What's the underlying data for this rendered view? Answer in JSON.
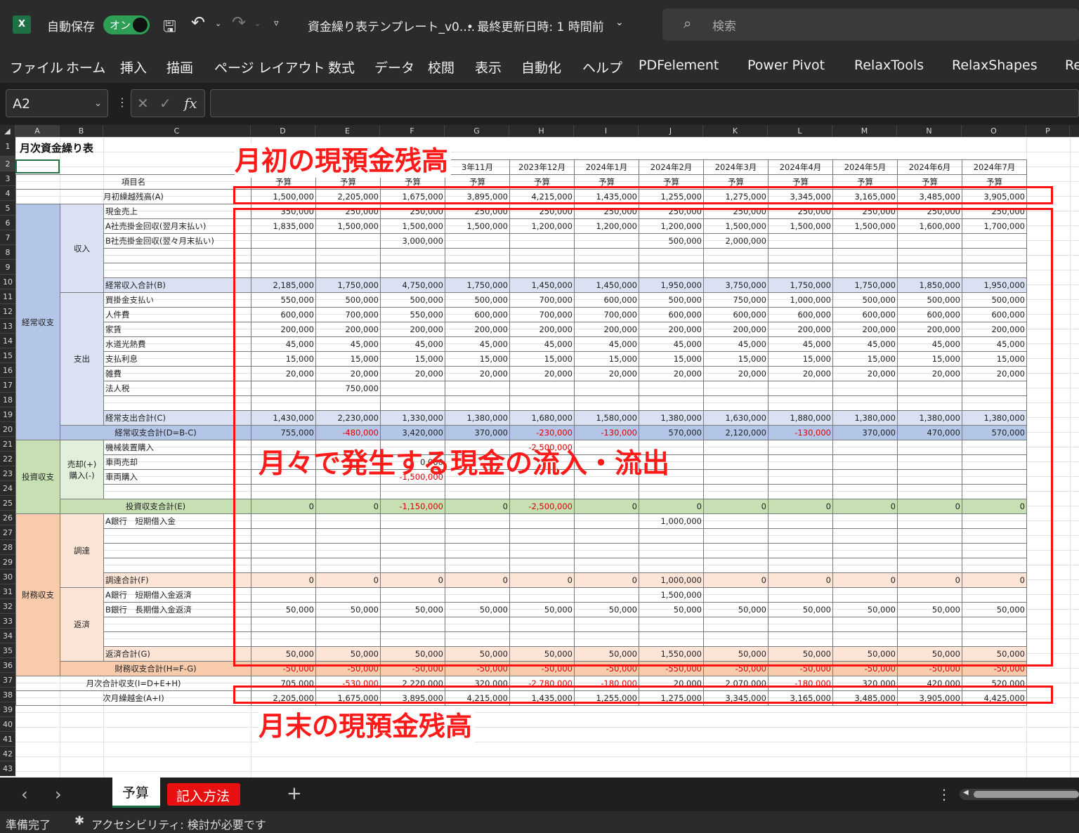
{
  "titlebar": {
    "app_icon": "excel-icon",
    "autosave_label": "自動保存",
    "autosave_toggle": "オン",
    "filename": "資金繰り表テンプレート_v0.…",
    "last_modified": "• 最終更新日時: 1 時間前",
    "search_placeholder": "検索"
  },
  "menu": [
    "ファイル",
    "ホーム",
    "挿入",
    "描画",
    "ページ レイアウト",
    "数式",
    "データ",
    "校閲",
    "表示",
    "自動化",
    "ヘルプ",
    "PDFelement",
    "Power Pivot",
    "RelaxTools",
    "RelaxShapes",
    "Re"
  ],
  "formula_bar": {
    "name_box": "A2",
    "fx": "fx",
    "value": ""
  },
  "columns": [
    "A",
    "B",
    "C",
    "D",
    "E",
    "F",
    "G",
    "H",
    "I",
    "J",
    "K",
    "L",
    "M",
    "N",
    "O",
    "P"
  ],
  "rows": [
    "1",
    "2",
    "3",
    "4",
    "5",
    "6",
    "7",
    "8",
    "9",
    "10",
    "11",
    "12",
    "13",
    "14",
    "15",
    "16",
    "17",
    "18",
    "19",
    "20",
    "21",
    "22",
    "23",
    "24",
    "25",
    "26",
    "27",
    "28",
    "29",
    "30",
    "31",
    "32",
    "33",
    "34",
    "35",
    "36",
    "37",
    "38",
    "39",
    "40",
    "41",
    "42",
    "43"
  ],
  "sheet": {
    "title": "月次資金繰り表",
    "months": [
      "",
      "",
      "",
      "3年11月",
      "2023年12月",
      "2024年1月",
      "2024年2月",
      "2024年3月",
      "2024年4月",
      "2024年5月",
      "2024年6月",
      "2024年7月"
    ],
    "item_header": "項目名",
    "budget_label": "予算",
    "rows": [
      {
        "r": "4",
        "a": "",
        "b": "",
        "c": "月初繰越残高(A)",
        "cls": "open",
        "vals": [
          "1,500,000",
          "2,205,000",
          "1,675,000",
          "3,895,000",
          "4,215,000",
          "1,435,000",
          "1,255,000",
          "1,275,000",
          "3,345,000",
          "3,165,000",
          "3,485,000",
          "3,905,000"
        ]
      },
      {
        "r": "5",
        "c": "現金売上",
        "vals": [
          "350,000",
          "250,000",
          "250,000",
          "250,000",
          "250,000",
          "250,000",
          "250,000",
          "250,000",
          "250,000",
          "250,000",
          "250,000",
          "250,000"
        ]
      },
      {
        "r": "6",
        "c": "A社売掛金回収(翌月末払い)",
        "vals": [
          "1,835,000",
          "1,500,000",
          "1,500,000",
          "1,500,000",
          "1,200,000",
          "1,200,000",
          "1,200,000",
          "1,500,000",
          "1,500,000",
          "1,500,000",
          "1,600,000",
          "1,700,000"
        ]
      },
      {
        "r": "7",
        "c": "B社売掛金回収(翌々月末払い)",
        "vals": [
          "",
          "",
          "3,000,000",
          "",
          "",
          "",
          "500,000",
          "2,000,000",
          "",
          "",
          "",
          ""
        ]
      },
      {
        "r": "8",
        "c": "",
        "vals": [
          "",
          "",
          "",
          "",
          "",
          "",
          "",
          "",
          "",
          "",
          "",
          ""
        ]
      },
      {
        "r": "9",
        "c": "",
        "vals": [
          "",
          "",
          "",
          "",
          "",
          "",
          "",
          "",
          "",
          "",
          "",
          ""
        ]
      },
      {
        "r": "10",
        "c": "経常収入合計(B)",
        "cls": "sumblue",
        "vals": [
          "2,185,000",
          "1,750,000",
          "4,750,000",
          "1,750,000",
          "1,450,000",
          "1,450,000",
          "1,950,000",
          "3,750,000",
          "1,750,000",
          "1,750,000",
          "1,850,000",
          "1,950,000"
        ]
      },
      {
        "r": "11",
        "c": "買掛金支払い",
        "vals": [
          "550,000",
          "500,000",
          "500,000",
          "500,000",
          "700,000",
          "600,000",
          "500,000",
          "750,000",
          "1,000,000",
          "500,000",
          "500,000",
          "500,000"
        ]
      },
      {
        "r": "12",
        "c": "人件費",
        "vals": [
          "600,000",
          "700,000",
          "550,000",
          "600,000",
          "700,000",
          "700,000",
          "600,000",
          "600,000",
          "600,000",
          "600,000",
          "600,000",
          "600,000"
        ]
      },
      {
        "r": "13",
        "c": "家賃",
        "vals": [
          "200,000",
          "200,000",
          "200,000",
          "200,000",
          "200,000",
          "200,000",
          "200,000",
          "200,000",
          "200,000",
          "200,000",
          "200,000",
          "200,000"
        ]
      },
      {
        "r": "14",
        "c": "水道光熱費",
        "vals": [
          "45,000",
          "45,000",
          "45,000",
          "45,000",
          "45,000",
          "45,000",
          "45,000",
          "45,000",
          "45,000",
          "45,000",
          "45,000",
          "45,000"
        ]
      },
      {
        "r": "15",
        "c": "支払利息",
        "vals": [
          "15,000",
          "15,000",
          "15,000",
          "15,000",
          "15,000",
          "15,000",
          "15,000",
          "15,000",
          "15,000",
          "15,000",
          "15,000",
          "15,000"
        ]
      },
      {
        "r": "16",
        "c": "雑費",
        "vals": [
          "20,000",
          "20,000",
          "20,000",
          "20,000",
          "20,000",
          "20,000",
          "20,000",
          "20,000",
          "20,000",
          "20,000",
          "20,000",
          "20,000"
        ]
      },
      {
        "r": "17",
        "c": "法人税",
        "vals": [
          "",
          "750,000",
          "",
          "",
          "",
          "",
          "",
          "",
          "",
          "",
          "",
          ""
        ]
      },
      {
        "r": "18",
        "c": "",
        "vals": [
          "",
          "",
          "",
          "",
          "",
          "",
          "",
          "",
          "",
          "",
          "",
          ""
        ]
      },
      {
        "r": "19",
        "c": "経常支出合計(C)",
        "cls": "sumblue",
        "vals": [
          "1,430,000",
          "2,230,000",
          "1,330,000",
          "1,380,000",
          "1,680,000",
          "1,580,000",
          "1,380,000",
          "1,630,000",
          "1,880,000",
          "1,380,000",
          "1,380,000",
          "1,380,000"
        ]
      },
      {
        "r": "20",
        "c": "経常収支合計(D=B-C)",
        "cls": "sumblue2",
        "vals": [
          "755,000",
          "-480,000",
          "3,420,000",
          "370,000",
          "-230,000",
          "-130,000",
          "570,000",
          "2,120,000",
          "-130,000",
          "370,000",
          "470,000",
          "570,000"
        ]
      },
      {
        "r": "21",
        "c": "機械装置購入",
        "vals": [
          "",
          "",
          "",
          "",
          "-2,500,000",
          "",
          "",
          "",
          "",
          "",
          "",
          ""
        ]
      },
      {
        "r": "22",
        "c": "車両売却",
        "vals": [
          "",
          "",
          "0,000",
          "",
          "",
          "",
          "",
          "",
          "",
          "",
          "",
          ""
        ]
      },
      {
        "r": "23",
        "c": "車両購入",
        "vals": [
          "",
          "",
          "-1,500,000",
          "",
          "",
          "",
          "",
          "",
          "",
          "",
          "",
          ""
        ]
      },
      {
        "r": "24",
        "c": "",
        "vals": [
          "",
          "",
          "",
          "",
          "",
          "",
          "",
          "",
          "",
          "",
          "",
          ""
        ]
      },
      {
        "r": "25",
        "c": "投資収支合計(E)",
        "cls": "sumgreen",
        "vals": [
          "0",
          "0",
          "-1,150,000",
          "0",
          "-2,500,000",
          "0",
          "0",
          "0",
          "0",
          "0",
          "0",
          "0"
        ]
      },
      {
        "r": "26",
        "c": "A銀行　短期借入金",
        "vals": [
          "",
          "",
          "",
          "",
          "",
          "",
          "1,000,000",
          "",
          "",
          "",
          "",
          ""
        ]
      },
      {
        "r": "27",
        "c": "",
        "vals": [
          "",
          "",
          "",
          "",
          "",
          "",
          "",
          "",
          "",
          "",
          "",
          ""
        ]
      },
      {
        "r": "28",
        "c": "",
        "vals": [
          "",
          "",
          "",
          "",
          "",
          "",
          "",
          "",
          "",
          "",
          "",
          ""
        ]
      },
      {
        "r": "29",
        "c": "",
        "vals": [
          "",
          "",
          "",
          "",
          "",
          "",
          "",
          "",
          "",
          "",
          "",
          ""
        ]
      },
      {
        "r": "30",
        "c": "調達合計(F)",
        "cls": "sumorange",
        "vals": [
          "0",
          "0",
          "0",
          "0",
          "0",
          "0",
          "1,000,000",
          "0",
          "0",
          "0",
          "0",
          "0"
        ]
      },
      {
        "r": "31",
        "c": "A銀行　短期借入金返済",
        "vals": [
          "",
          "",
          "",
          "",
          "",
          "",
          "1,500,000",
          "",
          "",
          "",
          "",
          ""
        ]
      },
      {
        "r": "32",
        "c": "B銀行　長期借入金返済",
        "vals": [
          "50,000",
          "50,000",
          "50,000",
          "50,000",
          "50,000",
          "50,000",
          "50,000",
          "50,000",
          "50,000",
          "50,000",
          "50,000",
          "50,000"
        ]
      },
      {
        "r": "33",
        "c": "",
        "vals": [
          "",
          "",
          "",
          "",
          "",
          "",
          "",
          "",
          "",
          "",
          "",
          ""
        ]
      },
      {
        "r": "34",
        "c": "",
        "vals": [
          "",
          "",
          "",
          "",
          "",
          "",
          "",
          "",
          "",
          "",
          "",
          ""
        ]
      },
      {
        "r": "35",
        "c": "返済合計(G)",
        "cls": "sumorange",
        "vals": [
          "50,000",
          "50,000",
          "50,000",
          "50,000",
          "50,000",
          "50,000",
          "1,550,000",
          "50,000",
          "50,000",
          "50,000",
          "50,000",
          "50,000"
        ]
      },
      {
        "r": "36",
        "c": "財務収支合計(H=F-G)",
        "cls": "sumorange2",
        "vals": [
          "-50,000",
          "-50,000",
          "-50,000",
          "-50,000",
          "-50,000",
          "-50,000",
          "-550,000",
          "-50,000",
          "-50,000",
          "-50,000",
          "-50,000",
          "-50,000"
        ]
      },
      {
        "r": "37",
        "c": "月次合計収支(I=D+E+H)",
        "cls": "total",
        "vals": [
          "705,000",
          "-530,000",
          "2,220,000",
          "320,000",
          "-2,780,000",
          "-180,000",
          "20,000",
          "2,070,000",
          "-180,000",
          "320,000",
          "420,000",
          "520,000"
        ]
      },
      {
        "r": "38",
        "c": "次月繰越金(A+I)",
        "cls": "total",
        "vals": [
          "2,205,000",
          "1,675,000",
          "3,895,000",
          "4,215,000",
          "1,435,000",
          "1,255,000",
          "1,275,000",
          "3,345,000",
          "3,165,000",
          "3,485,000",
          "3,905,000",
          "4,425,000"
        ]
      }
    ],
    "groups": {
      "keijo": "経常収支",
      "shunyu": "収入",
      "shishutsu": "支出",
      "toushi": "投資収支",
      "baikyaku": "売却(+)",
      "konyu": "購入(-)",
      "zaimu": "財務収支",
      "chotatsu": "調達",
      "hensai": "返済"
    }
  },
  "annotations": {
    "top": "月初の現預金残高",
    "middle": "月々で発生する現金の流入・流出",
    "bottom": "月末の現預金残高",
    "color": "#ff1010"
  },
  "tabs": {
    "active": "予算",
    "second": "記入方法",
    "add": "+",
    "prev": "‹",
    "next": "›",
    "more": "⋮"
  },
  "status": {
    "ready": "準備完了",
    "accessibility": "アクセシビリティ: 検討が必要です"
  }
}
